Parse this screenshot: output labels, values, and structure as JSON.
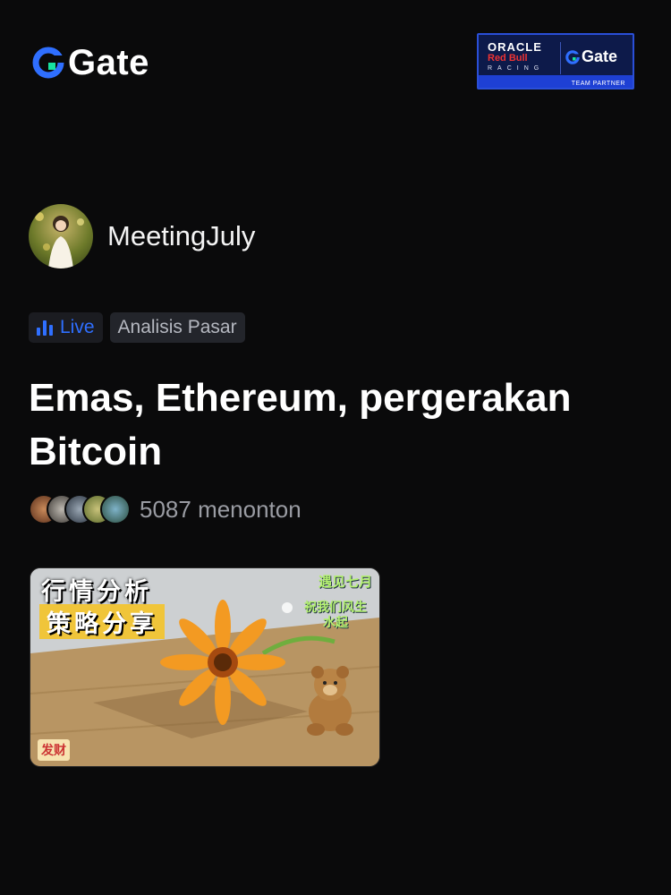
{
  "brand": {
    "name": "Gate",
    "accent": "#2f6fff",
    "green": "#17e3a0"
  },
  "partner": {
    "oracle": "ORACLE",
    "redbull": "Red Bull",
    "racing": "RACING",
    "gate": "Gate",
    "team": "TEAM PARTNER"
  },
  "host": {
    "name": "MeetingJuly",
    "avatar": "avatar"
  },
  "tags": {
    "live": "Live",
    "category": "Analisis Pasar"
  },
  "stream": {
    "title": "Emas, Ethereum, pergerakan Bitcoin",
    "viewers": "5087 menonton"
  },
  "thumbnail": {
    "line1": "行情分析",
    "line2": "策略分享",
    "top_right": "遇见七月",
    "right_text": "祝我们风生水起",
    "badge": "发财"
  }
}
